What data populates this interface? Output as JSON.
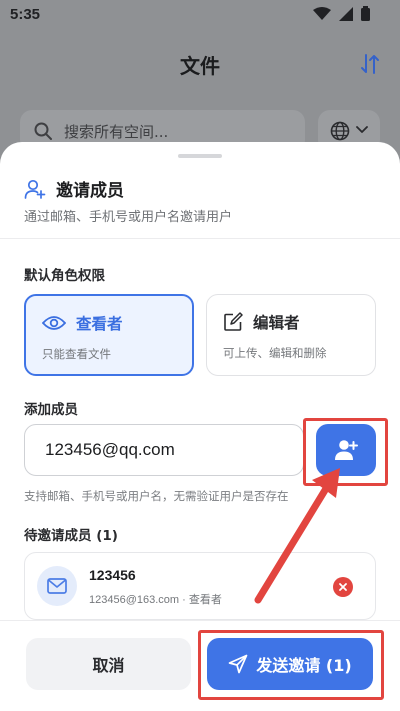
{
  "status_bar": {
    "time": "5:35"
  },
  "background_app": {
    "title": "文件",
    "search_placeholder": "搜索所有空间..."
  },
  "sheet": {
    "title": "邀请成员",
    "subtitle": "通过邮箱、手机号或用户名邀请用户",
    "role_section_label": "默认角色权限",
    "roles": [
      {
        "name": "查看者",
        "description": "只能查看文件",
        "selected": true
      },
      {
        "name": "编辑者",
        "description": "可上传、编辑和删除",
        "selected": false
      }
    ],
    "add_section_label": "添加成员",
    "member_input_value": "123456@qq.com",
    "hint": "支持邮箱、手机号或用户名，无需验证用户是否存在",
    "pending_label": "待邀请成员 (1)",
    "pending": [
      {
        "name": "123456",
        "meta": "123456@163.com · 查看者"
      }
    ],
    "cancel_label": "取消",
    "send_label": "发送邀请 (1)"
  },
  "colors": {
    "accent": "#3f74e6",
    "annotation": "#e2453f"
  },
  "icons": [
    "wifi-icon",
    "signal-icon",
    "battery-icon",
    "sort-icon",
    "search-icon",
    "globe-icon",
    "chevron-down-icon",
    "add-person-icon",
    "eye-icon",
    "edit-icon",
    "add-user-icon",
    "mail-icon",
    "close-icon",
    "send-icon"
  ]
}
